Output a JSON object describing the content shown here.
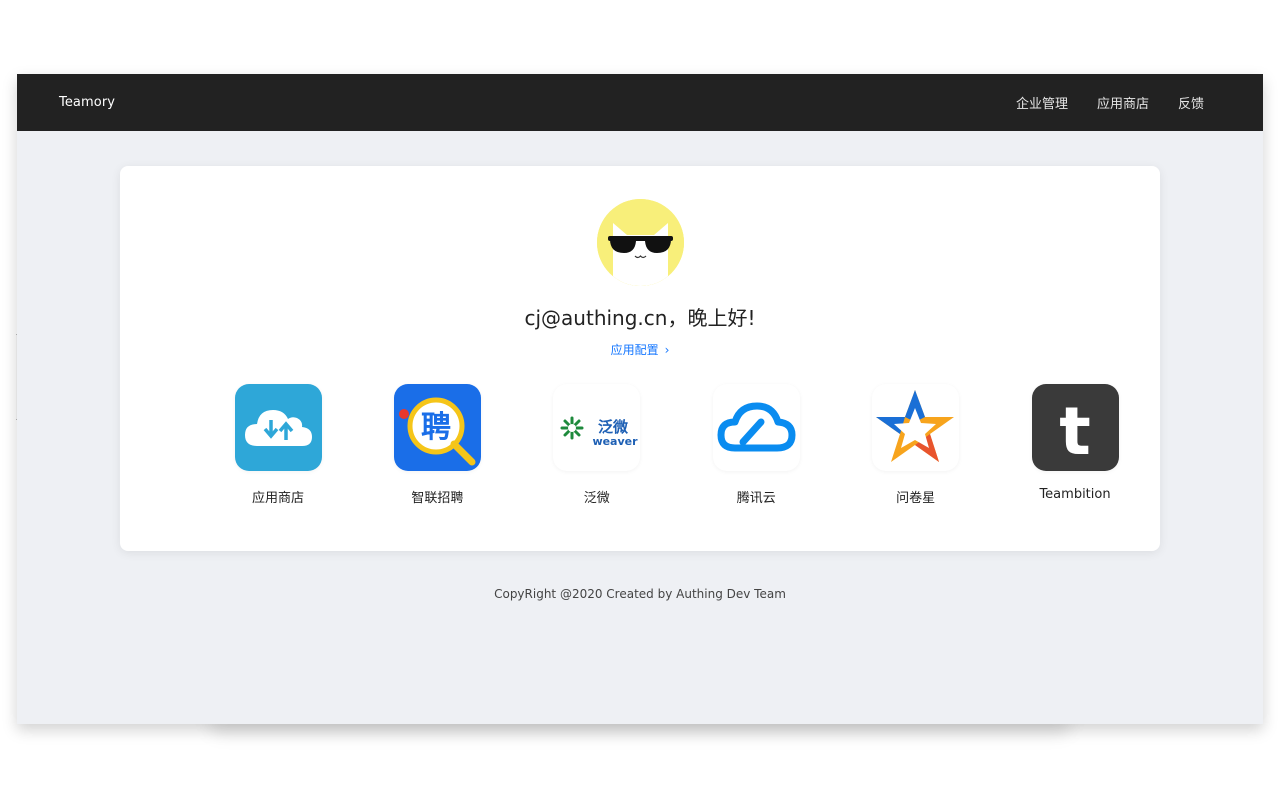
{
  "header": {
    "brand": "Teamory",
    "nav": [
      {
        "label": "企业管理"
      },
      {
        "label": "应用商店"
      },
      {
        "label": "反馈"
      }
    ]
  },
  "profile": {
    "greeting": "cj@authing.cn，晚上好!",
    "config_link": "应用配置",
    "avatar_icon": "sunglasses-cat-icon"
  },
  "apps": [
    {
      "label": "应用商店",
      "icon": "cloud-upload-download-icon"
    },
    {
      "label": "智联招聘",
      "icon": "zhaopin-icon",
      "logo_text": "聘"
    },
    {
      "label": "泛微",
      "icon": "weaver-icon",
      "logo_text": "泛微",
      "logo_sub": "weaver"
    },
    {
      "label": "腾讯云",
      "icon": "tencent-cloud-icon"
    },
    {
      "label": "问卷星",
      "icon": "star-icon"
    },
    {
      "label": "Teambition",
      "icon": "teambition-t-icon",
      "logo_text": "t"
    }
  ],
  "footer": {
    "text": "CopyRight @2020 Created by Authing Dev Team"
  },
  "colors": {
    "topbar": "#222222",
    "link": "#1677ff",
    "page_bg": "#eef0f4"
  }
}
